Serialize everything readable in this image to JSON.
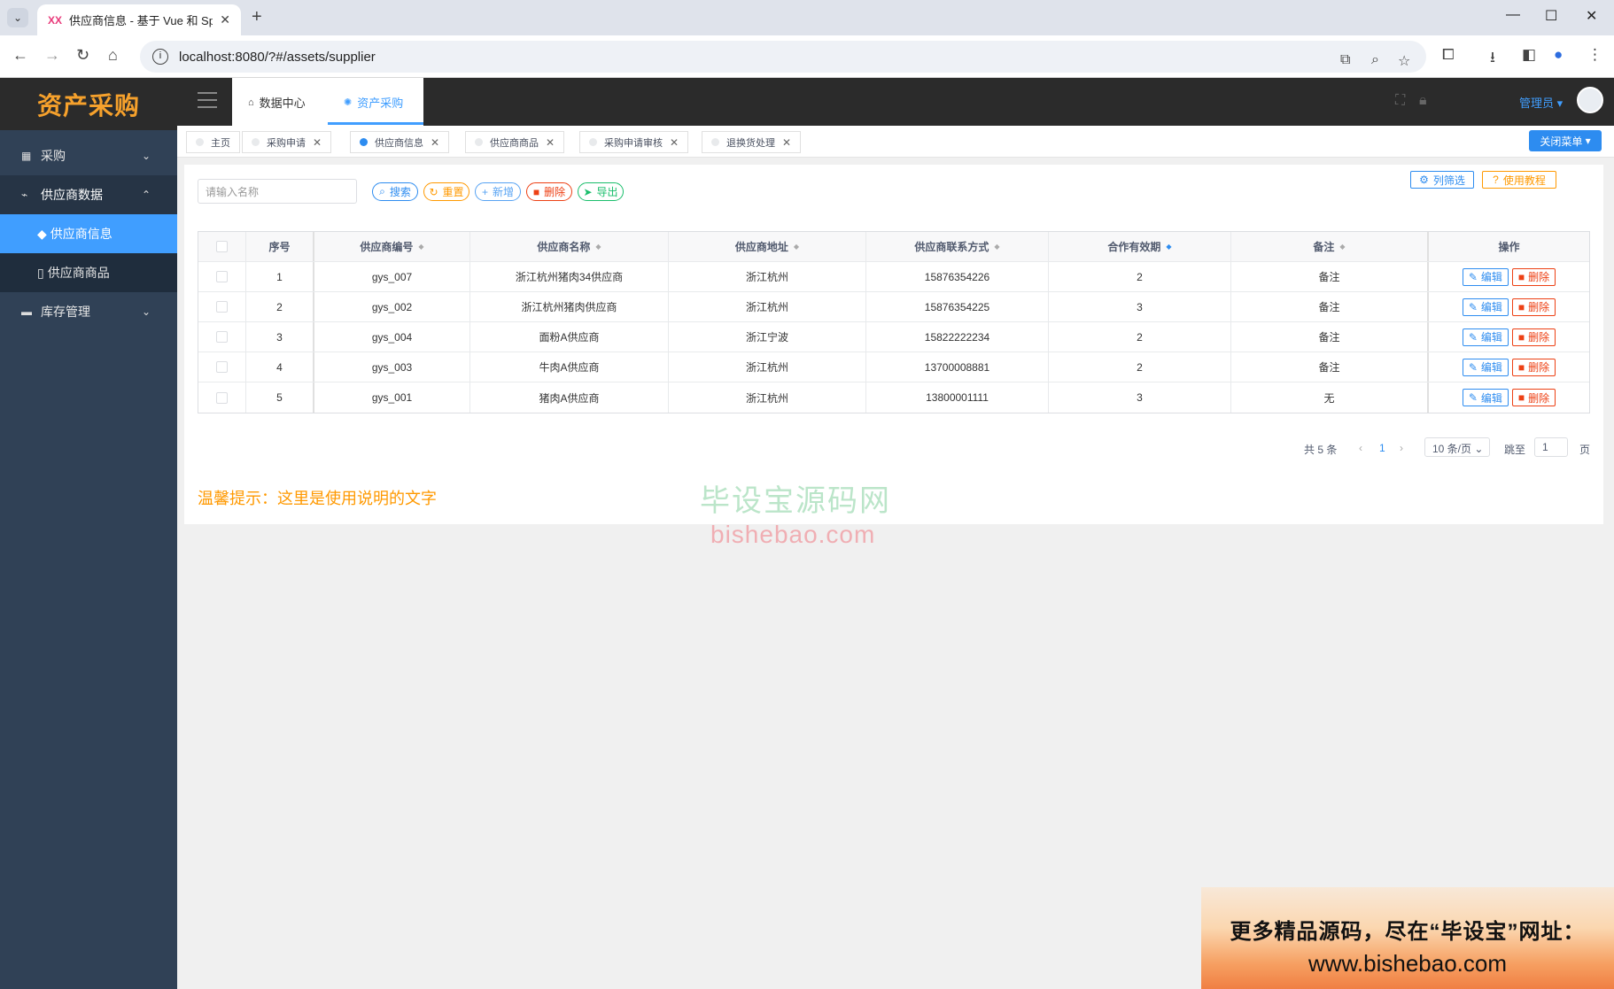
{
  "browser": {
    "tab_title": "供应商信息 - 基于 Vue 和 Spri",
    "tab_favicon": "XX",
    "url": "localhost:8080/?#/assets/supplier"
  },
  "app": {
    "logo": "资产采购",
    "sidebar": {
      "items": [
        {
          "label": "采购",
          "icon": "grid-icon"
        },
        {
          "label": "供应商数据",
          "icon": "chart-icon"
        },
        {
          "label": "库存管理",
          "icon": "briefcase-icon"
        }
      ],
      "sub_items": [
        {
          "label": "供应商信息",
          "icon": "tag-icon"
        },
        {
          "label": "供应商商品",
          "icon": "phone-icon"
        }
      ]
    },
    "top_tabs": [
      {
        "label": "数据中心",
        "icon": "home-icon"
      },
      {
        "label": "资产采购",
        "icon": "bug-icon"
      }
    ],
    "admin_label": "管理员",
    "tags": [
      {
        "label": "主页"
      },
      {
        "label": "采购申请"
      },
      {
        "label": "供应商信息"
      },
      {
        "label": "供应商商品"
      },
      {
        "label": "采购申请审核"
      },
      {
        "label": "退换货处理"
      }
    ],
    "close_menu_label": "关闭菜单"
  },
  "toolbar": {
    "search_placeholder": "请输入名称",
    "search_label": "搜索",
    "reset_label": "重置",
    "add_label": "新增",
    "delete_label": "删除",
    "export_label": "导出",
    "column_filter_label": "列筛选",
    "tutorial_label": "使用教程"
  },
  "table": {
    "headers": [
      "序号",
      "供应商编号",
      "供应商名称",
      "供应商地址",
      "供应商联系方式",
      "合作有效期",
      "备注",
      "操作"
    ],
    "rows": [
      {
        "no": "1",
        "code": "gys_007",
        "name": "浙江杭州猪肉34供应商",
        "address": "浙江杭州",
        "phone": "15876354226",
        "period": "2",
        "remark": "备注"
      },
      {
        "no": "2",
        "code": "gys_002",
        "name": "浙江杭州猪肉供应商",
        "address": "浙江杭州",
        "phone": "15876354225",
        "period": "3",
        "remark": "备注"
      },
      {
        "no": "3",
        "code": "gys_004",
        "name": "面粉A供应商",
        "address": "浙江宁波",
        "phone": "15822222234",
        "period": "2",
        "remark": "备注"
      },
      {
        "no": "4",
        "code": "gys_003",
        "name": "牛肉A供应商",
        "address": "浙江杭州",
        "phone": "13700008881",
        "period": "2",
        "remark": "备注"
      },
      {
        "no": "5",
        "code": "gys_001",
        "name": "猪肉A供应商",
        "address": "浙江杭州",
        "phone": "13800001111",
        "period": "3",
        "remark": "无"
      }
    ],
    "edit_label": "编辑",
    "delete_label": "删除"
  },
  "pagination": {
    "total": "共 5 条",
    "current_page": "1",
    "page_size": "10 条/页",
    "jump_label": "跳至",
    "jump_value": "1",
    "page_suffix": "页"
  },
  "hint": "温馨提示：这里是使用说明的文字",
  "watermark": {
    "cn": "毕设宝源码网",
    "en": "bishebao.com"
  },
  "ad": {
    "line1": "更多精品源码，尽在“毕设宝”网址：",
    "line2": "www.bishebao.com"
  }
}
